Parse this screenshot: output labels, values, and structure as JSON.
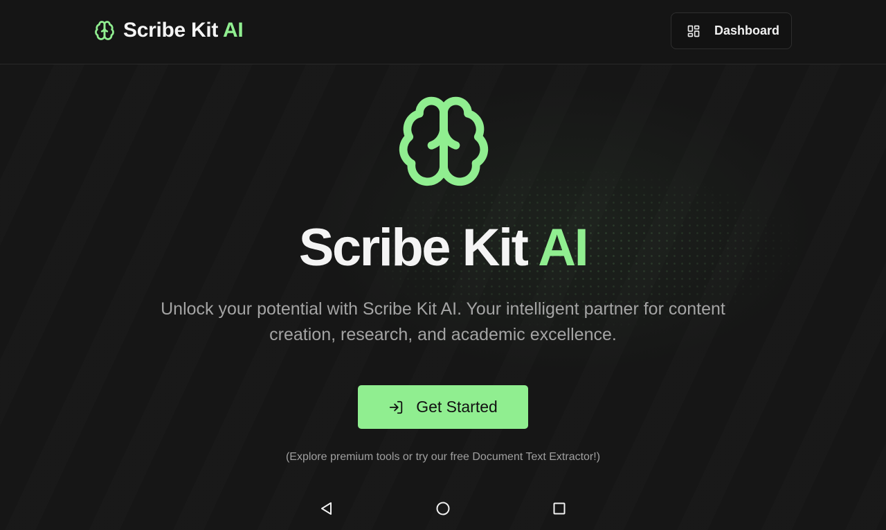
{
  "header": {
    "brand": {
      "name": "Scribe Kit",
      "accent": "AI",
      "icon": "brain-icon"
    },
    "dashboard_button": {
      "label": "Dashboard",
      "icon": "layout-dashboard-icon"
    }
  },
  "hero": {
    "icon": "brain-icon",
    "title": "Scribe Kit",
    "title_accent": "AI",
    "subtitle": "Unlock your potential with Scribe Kit AI. Your intelligent partner for content creation, research, and academic excellence.",
    "cta": {
      "label": "Get Started",
      "icon": "log-in-icon"
    },
    "note": "(Explore premium tools or try our free Document Text Extractor!)"
  },
  "system_nav": {
    "back": "back-icon",
    "home": "home-icon",
    "recents": "recents-icon"
  },
  "colors": {
    "background": "#161616",
    "accent": "#90ee90",
    "text": "#f4f4f4",
    "muted": "#a4a4a4"
  }
}
